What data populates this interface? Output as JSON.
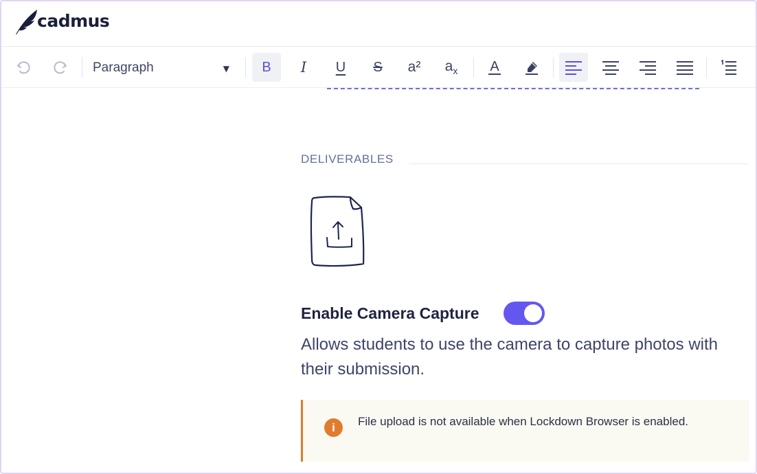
{
  "app": {
    "logo_text": "cadmus"
  },
  "toolbar": {
    "block_format": "Paragraph",
    "buttons": {
      "bold": "B",
      "italic": "I",
      "underline": "U",
      "strikethrough": "S",
      "superscript": "a²",
      "subscript_base": "a",
      "subscript_sub": "x",
      "text_color": "A"
    },
    "active": [
      "bold",
      "align-left"
    ]
  },
  "section": {
    "label": "DELIVERABLES"
  },
  "camera_capture": {
    "title": "Enable Camera Capture",
    "enabled": true,
    "description": "Allows students to use the camera to capture photos with their submission."
  },
  "notice": {
    "icon": "i",
    "text": "File upload is not available when Lockdown Browser is enabled."
  },
  "colors": {
    "accent": "#6457f0",
    "warning": "#e07c2e",
    "border": "#e2d3f4"
  }
}
